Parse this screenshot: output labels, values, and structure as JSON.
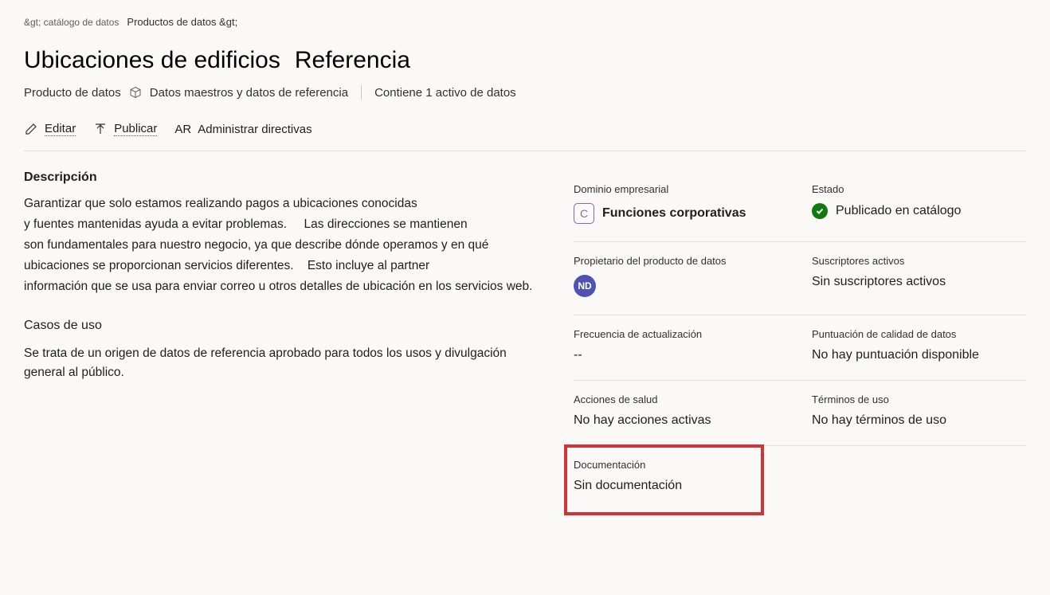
{
  "breadcrumb": {
    "catalog": "&gt; catálogo de datos",
    "products": "Productos de datos &gt;"
  },
  "header": {
    "title": "Ubicaciones de edificios",
    "category": "Referencia",
    "type_label": "Producto de datos",
    "subtype": "Datos maestros y datos de referencia",
    "contains": "Contiene 1 activo de datos"
  },
  "toolbar": {
    "edit": "Editar",
    "publish": "Publicar",
    "ar": "AR",
    "manage_policies": "Administrar directivas"
  },
  "description": {
    "heading": "Descripción",
    "line1": "Garantizar que solo estamos realizando pagos a ubicaciones conocidas",
    "line2a": "y fuentes mantenidas ayuda a evitar problemas.",
    "line2b": "Las direcciones se mantienen",
    "line3": "son fundamentales para nuestro negocio, ya que describe dónde operamos y en qué",
    "line4a": "ubicaciones se proporcionan servicios diferentes.",
    "line4b": "Esto incluye al partner",
    "line5": "información que se usa para enviar correo u otros detalles de ubicación en los servicios web."
  },
  "usecases": {
    "heading": "Casos de uso",
    "text": "Se trata de un origen de datos de referencia aprobado para todos los usos y divulgación general al público."
  },
  "info": {
    "domain": {
      "label": "Dominio empresarial",
      "badge": "C",
      "value": "Funciones corporativas"
    },
    "status": {
      "label": "Estado",
      "value": "Publicado en catálogo"
    },
    "owner": {
      "label": "Propietario del producto de datos",
      "avatar": "ND"
    },
    "subscribers": {
      "label": "Suscriptores activos",
      "value": "Sin suscriptores activos"
    },
    "frequency": {
      "label": "Frecuencia de actualización",
      "value": "--"
    },
    "quality": {
      "label": "Puntuación de calidad de datos",
      "value": "No hay puntuación disponible"
    },
    "health": {
      "label": "Acciones de salud",
      "value": "No hay acciones activas"
    },
    "terms": {
      "label": "Términos de uso",
      "value": "No hay términos de uso"
    },
    "documentation": {
      "label": "Documentación",
      "value": "Sin documentación"
    }
  }
}
